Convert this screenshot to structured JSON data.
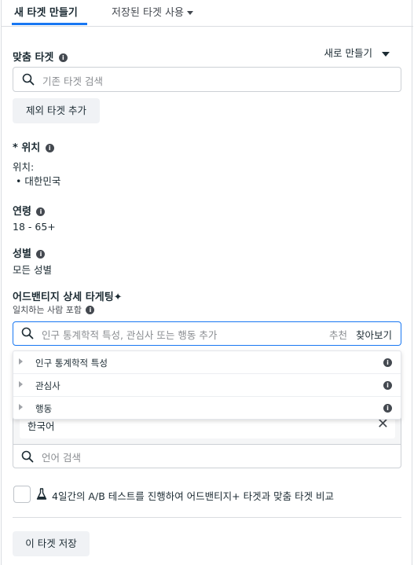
{
  "tabs": {
    "create_new": "새 타겟 만들기",
    "saved": "저장된 타겟 사용"
  },
  "custom_audience": {
    "label": "맞춤 타겟",
    "create_new": "새로 만들기",
    "search_placeholder": "기존 타겟 검색",
    "exclude_button": "제외 타겟 추가"
  },
  "location": {
    "label": "* 위치",
    "prefix": "위치:",
    "value": "• 대한민국"
  },
  "age": {
    "label": "연령",
    "value": "18 - 65+"
  },
  "gender": {
    "label": "성별",
    "value": "모든 성별"
  },
  "advantage_targeting": {
    "label": "어드밴티지 상세 타게팅✦",
    "sub": "일치하는 사람 포함",
    "search_placeholder": "인구 통계학적 특성, 관심사 또는 행동 추가",
    "suggest": "추천",
    "browse": "찾아보기",
    "dropdown_items": [
      {
        "label": "인구 통계학적 특성"
      },
      {
        "label": "관심사"
      },
      {
        "label": "행동"
      }
    ]
  },
  "language": {
    "chip": "한국어",
    "search_placeholder": "언어 검색"
  },
  "ab_test": {
    "label": "4일간의 A/B 테스트를 진행하여 어드밴티지+ 타겟과 맞춤 타겟 비교"
  },
  "save_button": "이 타겟 저장",
  "colors": {
    "accent": "#1877f2",
    "text": "#1c2b33",
    "button_bg": "#f0f2f5"
  }
}
